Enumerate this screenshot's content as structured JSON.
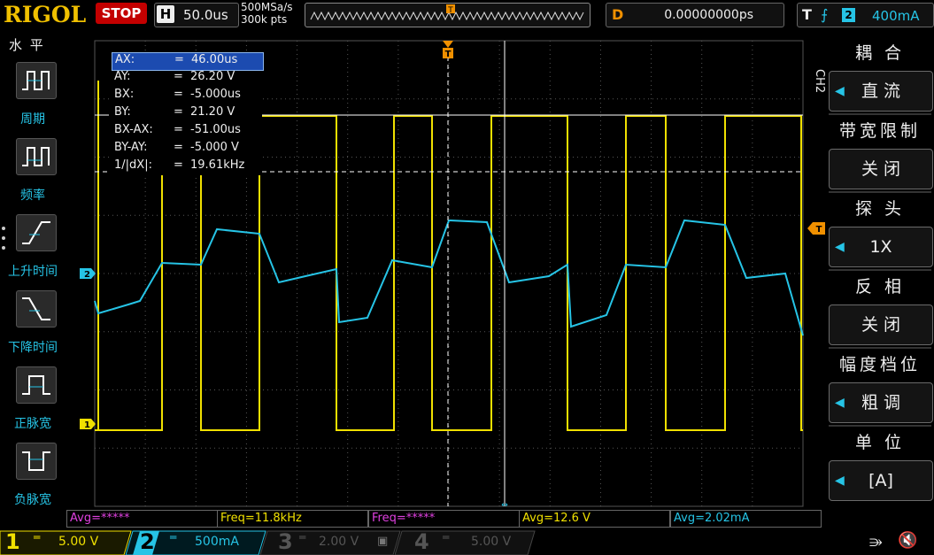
{
  "header": {
    "logo": "RIGOL",
    "run_state": "STOP",
    "timebase_tag": "H",
    "timebase_value": "50.0us",
    "sample_rate": "500MSa/s",
    "memory_depth": "300k pts",
    "delay_tag": "D",
    "delay_value": "0.00000000ps",
    "trigger_tag": "T",
    "trigger_source": "2",
    "trigger_level": "400mA"
  },
  "left_menu": {
    "title": "水 平",
    "items": [
      {
        "label": "周期",
        "icon": "period-icon"
      },
      {
        "label": "频率",
        "icon": "frequency-icon"
      },
      {
        "label": "上升时间",
        "icon": "rise-time-icon"
      },
      {
        "label": "下降时间",
        "icon": "fall-time-icon"
      },
      {
        "label": "正脉宽",
        "icon": "positive-width-icon"
      },
      {
        "label": "负脉宽",
        "icon": "negative-width-icon"
      }
    ]
  },
  "cursor_readout": [
    {
      "key": "AX:",
      "value": "46.00us"
    },
    {
      "key": "AY:",
      "value": "26.20 V"
    },
    {
      "key": "BX:",
      "value": "-5.000us"
    },
    {
      "key": "BY:",
      "value": "21.20 V"
    },
    {
      "key": "BX-AX:",
      "value": "-51.00us"
    },
    {
      "key": "BY-AY:",
      "value": "-5.000 V"
    },
    {
      "key": "1/|dX|:",
      "value": "19.61kHz"
    }
  ],
  "markers": {
    "ch1_marker": "1",
    "ch2_marker": "2",
    "trigger_marker": "T"
  },
  "measurements": [
    {
      "text": "Avg=*****",
      "color": "#e040e0"
    },
    {
      "text": "Freq=11.8kHz",
      "color": "#f0e000"
    },
    {
      "text": "Freq=*****",
      "color": "#e040e0"
    },
    {
      "text": "Avg=12.6 V",
      "color": "#f0e000"
    },
    {
      "text": "Avg=2.02mA",
      "color": "#26c4e6"
    }
  ],
  "channels": [
    {
      "num": "1",
      "value": "5.00 V",
      "color": "#f0e000",
      "active": true
    },
    {
      "num": "2",
      "value": "500mA",
      "color": "#26c4e6",
      "active": true
    },
    {
      "num": "3",
      "value": "2.00 V",
      "color": "#555555",
      "active": false
    },
    {
      "num": "4",
      "value": "5.00 V",
      "color": "#555555",
      "active": false
    }
  ],
  "right_menu": {
    "channel_tab": "CH2",
    "items": [
      {
        "title": "耦 合",
        "value": "直 流",
        "has_arrow": true
      },
      {
        "title": "带宽限制",
        "value": "关 闭",
        "has_arrow": false
      },
      {
        "title": "探 头",
        "value": "1X",
        "has_arrow": true
      },
      {
        "title": "反 相",
        "value": "关 闭",
        "has_arrow": false
      },
      {
        "title": "幅度档位",
        "value": "粗 调",
        "has_arrow": true
      },
      {
        "title": "单 位",
        "value": "[A]",
        "has_arrow": true
      }
    ]
  },
  "colors": {
    "ch1": "#f0e000",
    "ch2": "#26c4e6",
    "trigger": "#f09000",
    "stop": "#c30000"
  },
  "status_icons": [
    "usb-icon",
    "speaker-muted-icon"
  ]
}
